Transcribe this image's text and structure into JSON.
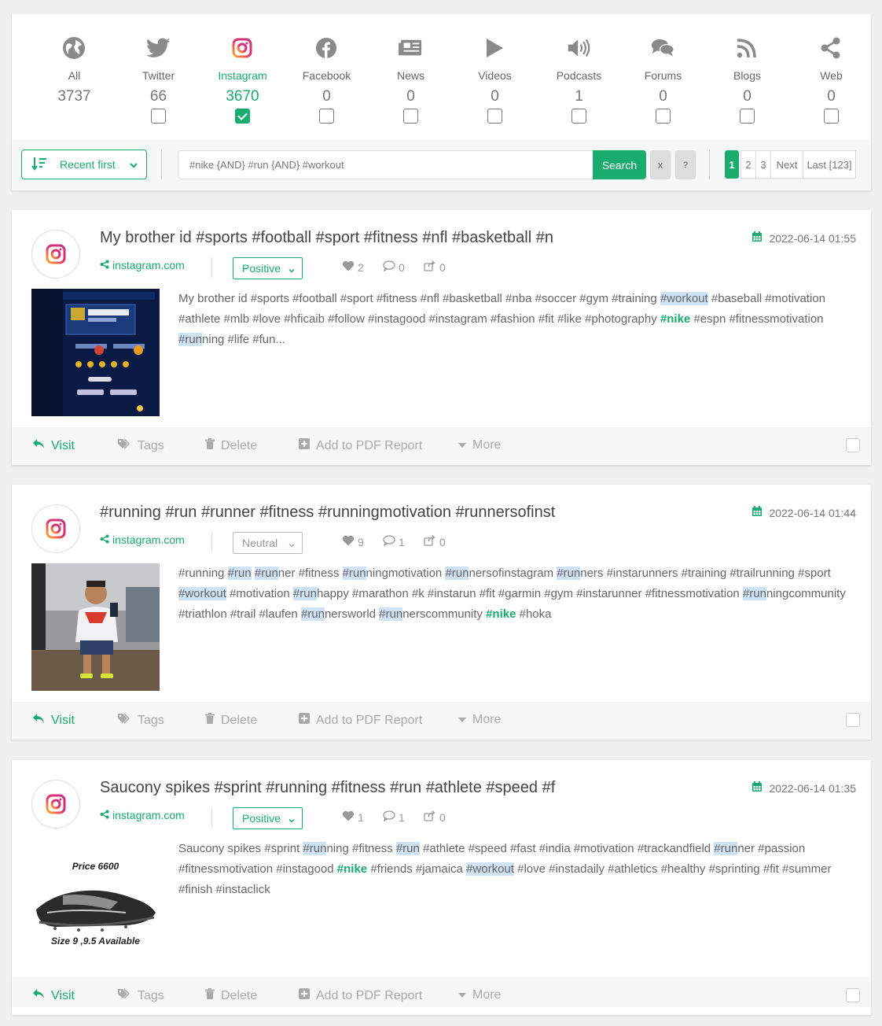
{
  "sources": [
    {
      "label": "All",
      "count": "3737",
      "icon": "globe-icon",
      "active": false,
      "checkbox": false
    },
    {
      "label": "Twitter",
      "count": "66",
      "icon": "twitter-icon",
      "active": false,
      "checkbox": true
    },
    {
      "label": "Instagram",
      "count": "3670",
      "icon": "instagram-icon",
      "active": true,
      "checkbox": true
    },
    {
      "label": "Facebook",
      "count": "0",
      "icon": "facebook-icon",
      "active": false,
      "checkbox": true
    },
    {
      "label": "News",
      "count": "0",
      "icon": "newspaper-icon",
      "active": false,
      "checkbox": true
    },
    {
      "label": "Videos",
      "count": "0",
      "icon": "play-icon",
      "active": false,
      "checkbox": true
    },
    {
      "label": "Podcasts",
      "count": "1",
      "icon": "volume-icon",
      "active": false,
      "checkbox": true
    },
    {
      "label": "Forums",
      "count": "0",
      "icon": "comments-icon",
      "active": false,
      "checkbox": true
    },
    {
      "label": "Blogs",
      "count": "0",
      "icon": "rss-icon",
      "active": false,
      "checkbox": true
    },
    {
      "label": "Web",
      "count": "0",
      "icon": "share-icon",
      "active": false,
      "checkbox": true
    }
  ],
  "toolbar": {
    "sort_label": "Recent first",
    "search_value": "#nike {AND} #run {AND} #workout",
    "search_button": "Search",
    "clear_button": "x",
    "help_button": "?"
  },
  "pagination": {
    "pages": [
      "1",
      "2",
      "3"
    ],
    "current": "1",
    "next": "Next",
    "last": "Last [123]"
  },
  "actions": {
    "visit": "Visit",
    "tags": "Tags",
    "delete": "Delete",
    "add_pdf": "Add to PDF Report",
    "more": "More"
  },
  "posts": [
    {
      "title": "My brother id #sports #football #sport #fitness #nfl #basketball #n",
      "date": "2022-06-14 01:55",
      "source": "instagram.com",
      "sentiment": "Positive",
      "likes": "2",
      "comments": "0",
      "shares": "0",
      "text_segments": [
        {
          "t": "My brother id #sports #football #sport #fitness #nfl #basketball #nba #soccer #gym #training ",
          "s": ""
        },
        {
          "t": "#workout",
          "s": "hl"
        },
        {
          "t": " #baseball #motivation #athlete #mlb #love #hficaib #follow #instagood #instagram #fashion #fit #like #photography ",
          "s": ""
        },
        {
          "t": "#nike",
          "s": "kw"
        },
        {
          "t": " #espn #fitnessmotivation ",
          "s": ""
        },
        {
          "t": "#run",
          "s": "hl"
        },
        {
          "t": "ning #life #fun...",
          "s": ""
        }
      ],
      "thumb": "game-screenshot"
    },
    {
      "title": "#running #run #runner #fitness #runningmotivation #runnersofinst",
      "date": "2022-06-14 01:44",
      "source": "instagram.com",
      "sentiment": "Neutral",
      "likes": "9",
      "comments": "1",
      "shares": "0",
      "text_segments": [
        {
          "t": "#running ",
          "s": ""
        },
        {
          "t": "#run",
          "s": "hl"
        },
        {
          "t": " ",
          "s": ""
        },
        {
          "t": "#run",
          "s": "hl"
        },
        {
          "t": "ner #fitness ",
          "s": ""
        },
        {
          "t": "#run",
          "s": "hl"
        },
        {
          "t": "ningmotivation ",
          "s": ""
        },
        {
          "t": "#run",
          "s": "hl"
        },
        {
          "t": "nersofinstagram ",
          "s": ""
        },
        {
          "t": "#run",
          "s": "hl"
        },
        {
          "t": "ners #instarunners #training #trailrunning #sport ",
          "s": ""
        },
        {
          "t": "#workout",
          "s": "hl"
        },
        {
          "t": " #motivation ",
          "s": ""
        },
        {
          "t": "#run",
          "s": "hl"
        },
        {
          "t": "happy #marathon #k #instarun #fit #garmin #gym #instarunner #fitnessmotivation ",
          "s": ""
        },
        {
          "t": "#run",
          "s": "hl"
        },
        {
          "t": "ningcommunity #triathlon #trail #laufen ",
          "s": ""
        },
        {
          "t": "#run",
          "s": "hl"
        },
        {
          "t": "nersworld ",
          "s": ""
        },
        {
          "t": "#run",
          "s": "hl"
        },
        {
          "t": "nerscommunity ",
          "s": ""
        },
        {
          "t": "#nike",
          "s": "kw"
        },
        {
          "t": " #hoka",
          "s": ""
        }
      ],
      "thumb": "gym-selfie"
    },
    {
      "title": "Saucony spikes #sprint #running #fitness #run #athlete #speed #f",
      "date": "2022-06-14 01:35",
      "source": "instagram.com",
      "sentiment": "Positive",
      "likes": "1",
      "comments": "1",
      "shares": "0",
      "text_segments": [
        {
          "t": "Saucony spikes #sprint ",
          "s": ""
        },
        {
          "t": "#run",
          "s": "hl"
        },
        {
          "t": "ning #fitness ",
          "s": ""
        },
        {
          "t": "#run",
          "s": "hl"
        },
        {
          "t": " #athlete #speed #fast #india #motivation #trackandfield ",
          "s": ""
        },
        {
          "t": "#run",
          "s": "hl"
        },
        {
          "t": "ner #passion #fitnessmotivation #instagood ",
          "s": ""
        },
        {
          "t": "#nike",
          "s": "kw"
        },
        {
          "t": " #friends #jamaica ",
          "s": ""
        },
        {
          "t": "#workout",
          "s": "hl"
        },
        {
          "t": " #love #instadaily #athletics #healthy #sprinting #fit #summer #finish #instaclick",
          "s": ""
        }
      ],
      "thumb": "shoe-ad",
      "thumb_text_top": "Price 6600",
      "thumb_text_bottom": "Size 9 ,9.5 Available"
    }
  ]
}
